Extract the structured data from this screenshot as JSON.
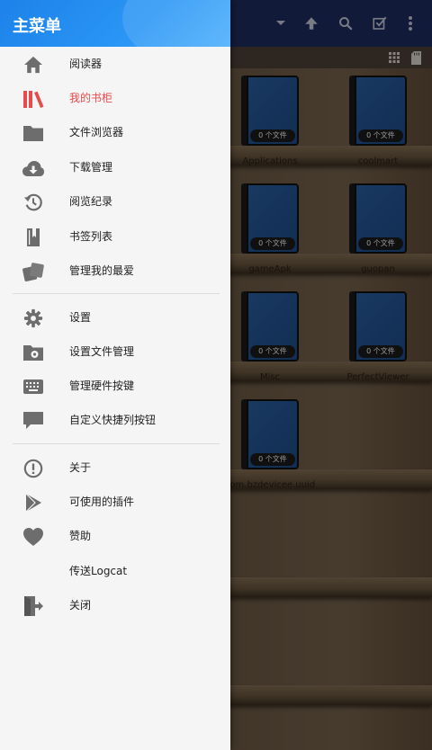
{
  "drawer": {
    "title": "主菜单",
    "sections": [
      {
        "items": [
          {
            "label": "阅读器",
            "icon": "home-icon"
          },
          {
            "label": "我的书柜",
            "icon": "library-icon",
            "active": true
          },
          {
            "label": "文件浏览器",
            "icon": "folder-icon"
          },
          {
            "label": "下载管理",
            "icon": "cloud-download-icon"
          },
          {
            "label": "阅览纪录",
            "icon": "history-icon"
          },
          {
            "label": "书签列表",
            "icon": "bookmark-icon"
          },
          {
            "label": "管理我的最爱",
            "icon": "favorites-icon"
          }
        ]
      },
      {
        "items": [
          {
            "label": "设置",
            "icon": "gear-icon"
          },
          {
            "label": "设置文件管理",
            "icon": "folder-settings-icon"
          },
          {
            "label": "管理硬件按键",
            "icon": "keyboard-icon"
          },
          {
            "label": "自定义快捷列按钮",
            "icon": "comment-icon"
          }
        ]
      },
      {
        "items": [
          {
            "label": "关于",
            "icon": "info-icon"
          },
          {
            "label": "可使用的插件",
            "icon": "play-store-icon"
          },
          {
            "label": "赞助",
            "icon": "heart-icon"
          },
          {
            "label": "传送Logcat",
            "icon": ""
          },
          {
            "label": "关闭",
            "icon": "exit-icon"
          }
        ]
      }
    ],
    "colors": {
      "header": "#2a8ff0",
      "active": "#e74c4c",
      "icon": "#6d6d6d"
    }
  },
  "shelf": {
    "books": [
      {
        "name": "Applications",
        "badge": "0 个文件"
      },
      {
        "name": "coolmart",
        "badge": "0 个文件"
      },
      {
        "name": "gameApk",
        "badge": "0 个文件"
      },
      {
        "name": "guopan",
        "badge": "0 个文件"
      },
      {
        "name": "Misc",
        "badge": "0 个文件"
      },
      {
        "name": "PerfectViewer",
        "badge": "0 个文件"
      },
      {
        "name": "com.bzdevicee.uuid",
        "badge": "0 个文件"
      }
    ]
  },
  "toolbar": {
    "actions": [
      "dropdown-icon",
      "up-arrow-icon",
      "search-icon",
      "select-icon",
      "more-vert-icon"
    ],
    "secondary": [
      "grid-view-icon",
      "sd-card-icon"
    ]
  }
}
